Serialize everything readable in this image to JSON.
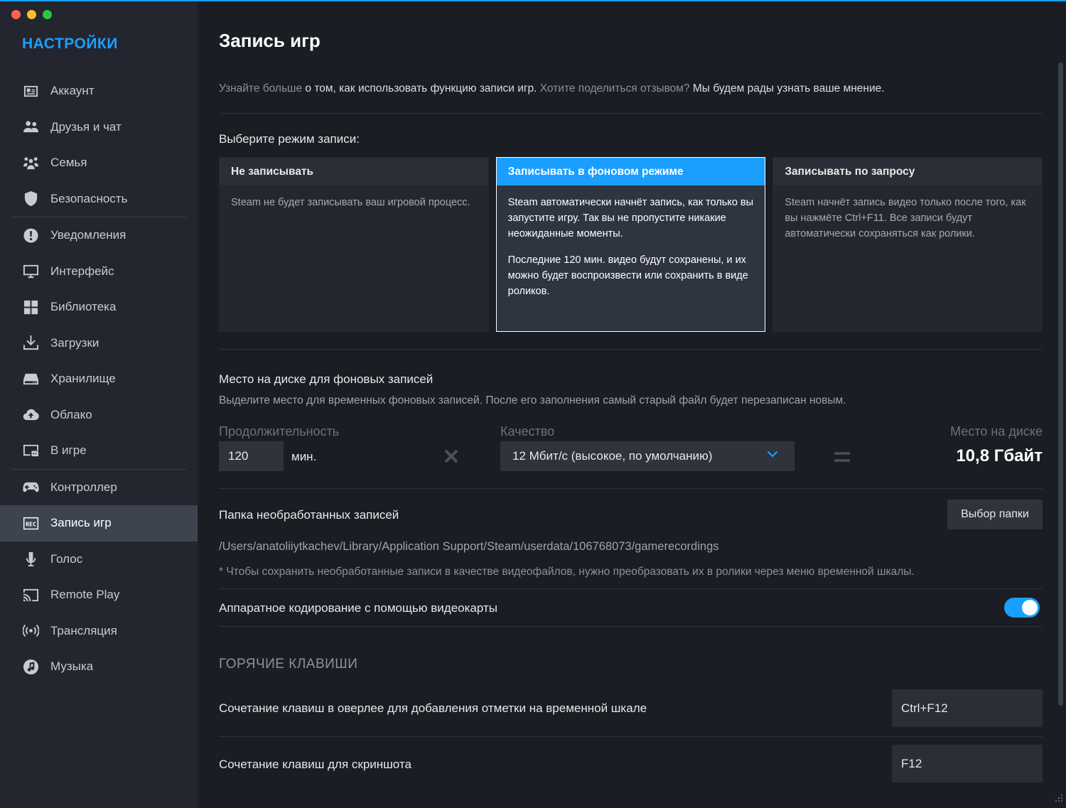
{
  "window": {
    "title": "НАСТРОЙКИ"
  },
  "sidebar": {
    "items": [
      {
        "label": "Аккаунт",
        "icon": "account-card-icon"
      },
      {
        "label": "Друзья и чат",
        "icon": "friends-icon"
      },
      {
        "label": "Семья",
        "icon": "family-icon"
      },
      {
        "label": "Безопасность",
        "icon": "shield-icon"
      },
      {
        "label": "Уведомления",
        "icon": "alert-icon"
      },
      {
        "label": "Интерфейс",
        "icon": "monitor-icon"
      },
      {
        "label": "Библиотека",
        "icon": "grid-icon"
      },
      {
        "label": "Загрузки",
        "icon": "download-icon"
      },
      {
        "label": "Хранилище",
        "icon": "drive-icon"
      },
      {
        "label": "Облако",
        "icon": "cloud-icon"
      },
      {
        "label": "В игре",
        "icon": "ingame-icon"
      },
      {
        "label": "Контроллер",
        "icon": "gamepad-icon"
      },
      {
        "label": "Запись игр",
        "icon": "rec-icon",
        "active": true
      },
      {
        "label": "Голос",
        "icon": "microphone-icon"
      },
      {
        "label": "Remote Play",
        "icon": "cast-icon"
      },
      {
        "label": "Трансляция",
        "icon": "broadcast-icon"
      },
      {
        "label": "Музыка",
        "icon": "music-icon"
      }
    ]
  },
  "main": {
    "title": "Запись игр",
    "intro": {
      "link1": "Узнайте больше",
      "text1": " о том, как использовать функцию записи игр. ",
      "link2": "Хотите поделиться отзывом?",
      "text2": " Мы будем рады узнать ваше мнение."
    },
    "mode": {
      "label": "Выберите режим записи:",
      "cards": [
        {
          "title": "Не записывать",
          "body": [
            "Steam не будет записывать ваш игровой процесс."
          ]
        },
        {
          "title": "Записывать в фоновом режиме",
          "body": [
            "Steam автоматически начнёт запись, как только вы запустите игру. Так вы не пропустите никакие неожиданные моменты.",
            "Последние 120 мин. видео будут сохранены, и их можно будет воспроизвести или сохранить в виде роликов."
          ],
          "selected": true
        },
        {
          "title": "Записывать по запросу",
          "body": [
            "Steam начнёт запись видео только после того, как вы нажмёте Ctrl+F11. Все записи будут автоматически сохраняться как ролики."
          ]
        }
      ]
    },
    "disk": {
      "title": "Место на диске для фоновых записей",
      "description": "Выделите место для временных фоновых записей. После его заполнения самый старый файл будет перезаписан новым.",
      "duration_label": "Продолжительность",
      "duration_value": "120",
      "duration_unit": "мин.",
      "quality_label": "Качество",
      "quality_value": "12 Мбит/с (высокое, по умолчанию)",
      "space_label": "Место на диске",
      "space_value": "10,8 Гбайт"
    },
    "folder": {
      "label": "Папка необработанных записей",
      "button": "Выбор папки",
      "path": "/Users/anatoliiytkachev/Library/Application Support/Steam/userdata/106768073/gamerecordings",
      "note": "* Чтобы сохранить необработанные записи в качестве видеофайлов, нужно преобразовать их в ролики через меню временной шкалы."
    },
    "hw_encoding": {
      "label": "Аппаратное кодирование с помощью видеокарты",
      "enabled": true
    },
    "hotkeys": {
      "title": "ГОРЯЧИЕ КЛАВИШИ",
      "items": [
        {
          "label": "Сочетание клавиш в оверлее для добавления отметки на временной шкале",
          "value": "Ctrl+F12"
        },
        {
          "label": "Сочетание клавиш для скриншота",
          "value": "F12"
        }
      ]
    }
  },
  "colors": {
    "accent": "#1a9fff",
    "sidebar_bg": "#23262e",
    "main_bg": "#1a1d23"
  }
}
